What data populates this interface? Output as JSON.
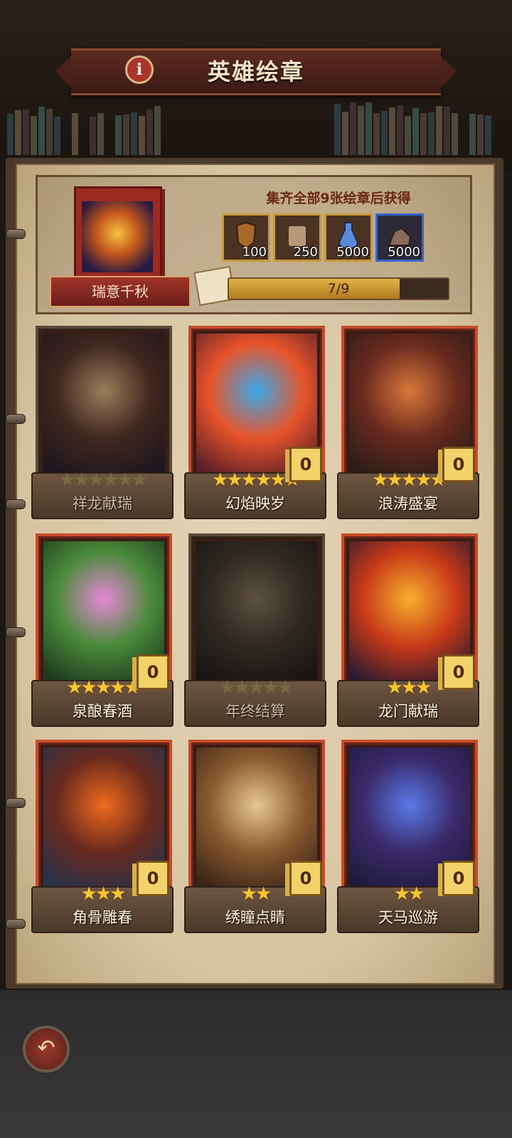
{
  "title": "英雄绘章",
  "info_icon": "i",
  "album": {
    "name": "瑞意千秋",
    "collect_text": "集齐全部9张绘章后获得",
    "progress_text": "7/9",
    "progress": {
      "current": 7,
      "total": 9
    }
  },
  "rewards": [
    {
      "icon": "armor-icon",
      "qty": "100",
      "rarity": "gold"
    },
    {
      "icon": "scroll-icon",
      "qty": "250",
      "rarity": "gold"
    },
    {
      "icon": "potion-icon",
      "qty": "5000",
      "rarity": "gold"
    },
    {
      "icon": "ore-icon",
      "qty": "5000",
      "rarity": "blue"
    }
  ],
  "cards": [
    {
      "name": "祥龙献瑞",
      "stars": "★★★★★★",
      "star_count": 6,
      "dup": "",
      "locked": true,
      "colors": [
        "#f2a33a",
        "#7a2a18",
        "#2a1c30"
      ]
    },
    {
      "name": "幻焰映岁",
      "stars": "★★★★★★",
      "star_count": 6,
      "dup": "0",
      "locked": false,
      "colors": [
        "#3aa8e8",
        "#e8542a",
        "#5a1e28"
      ]
    },
    {
      "name": "浪涛盛宴",
      "stars": "★★★★★",
      "star_count": 5,
      "dup": "0",
      "locked": false,
      "colors": [
        "#d8783a",
        "#6a2a1e",
        "#2a1c18"
      ]
    },
    {
      "name": "泉酿春酒",
      "stars": "★★★★★",
      "star_count": 5,
      "dup": "0",
      "locked": false,
      "colors": [
        "#e888d8",
        "#4a8a3a",
        "#1e3a1e"
      ]
    },
    {
      "name": "年终结算",
      "stars": "★★★★★",
      "star_count": 5,
      "dup": "",
      "locked": true,
      "colors": [
        "#8a6a3a",
        "#4a3422",
        "#241a12"
      ]
    },
    {
      "name": "龙门献瑞",
      "stars": "★★★",
      "star_count": 3,
      "dup": "0",
      "locked": false,
      "colors": [
        "#f8b030",
        "#c83a18",
        "#2a1a30"
      ]
    },
    {
      "name": "角骨雕春",
      "stars": "★★★",
      "star_count": 3,
      "dup": "0",
      "locked": false,
      "colors": [
        "#f06a1e",
        "#6a2a1e",
        "#24314a"
      ]
    },
    {
      "name": "绣瞳点睛",
      "stars": "★★",
      "star_count": 2,
      "dup": "0",
      "locked": false,
      "colors": [
        "#e8c890",
        "#8a5a30",
        "#3a2418"
      ]
    },
    {
      "name": "天马巡游",
      "stars": "★★",
      "star_count": 2,
      "dup": "0",
      "locked": false,
      "colors": [
        "#5a7ae8",
        "#3a2a6a",
        "#1e1a3a"
      ]
    }
  ],
  "back_icon": "↶",
  "colors": {
    "accent_red": "#c64c2a",
    "gold": "#f7c634",
    "paper": "#e5d6b8"
  }
}
